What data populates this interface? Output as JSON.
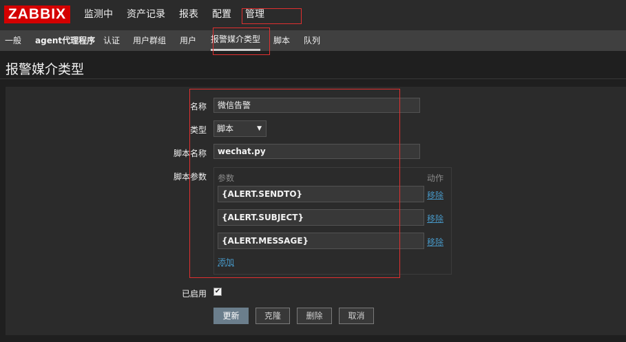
{
  "logo": "ZABBIX",
  "main_menu": [
    "监测中",
    "资产记录",
    "报表",
    "配置",
    "管理"
  ],
  "sub_menu": [
    "一般",
    "agent代理程序",
    "认证",
    "用户群组",
    "用户",
    "报警媒介类型",
    "脚本",
    "队列"
  ],
  "page_title": "报警媒介类型",
  "form": {
    "name_label": "名称",
    "name_value": "微信告警",
    "type_label": "类型",
    "type_value": "脚本",
    "script_name_label": "脚本名称",
    "script_name_value": "wechat.py",
    "script_params_label": "脚本参数",
    "params_header": "参数",
    "actions_header": "动作",
    "params": [
      {
        "value": "{ALERT.SENDTO}",
        "remove": "移除"
      },
      {
        "value": "{ALERT.SUBJECT}",
        "remove": "移除"
      },
      {
        "value": "{ALERT.MESSAGE}",
        "remove": "移除"
      }
    ],
    "add_label": "添加",
    "enabled_label": "已启用",
    "enabled": true
  },
  "buttons": {
    "update": "更新",
    "clone": "克隆",
    "delete": "删除",
    "cancel": "取消"
  },
  "colors": {
    "logo_bg": "#d40000",
    "link": "#4796c4",
    "highlight_box": "#e33030",
    "primary_button": "#6b7e8c"
  }
}
